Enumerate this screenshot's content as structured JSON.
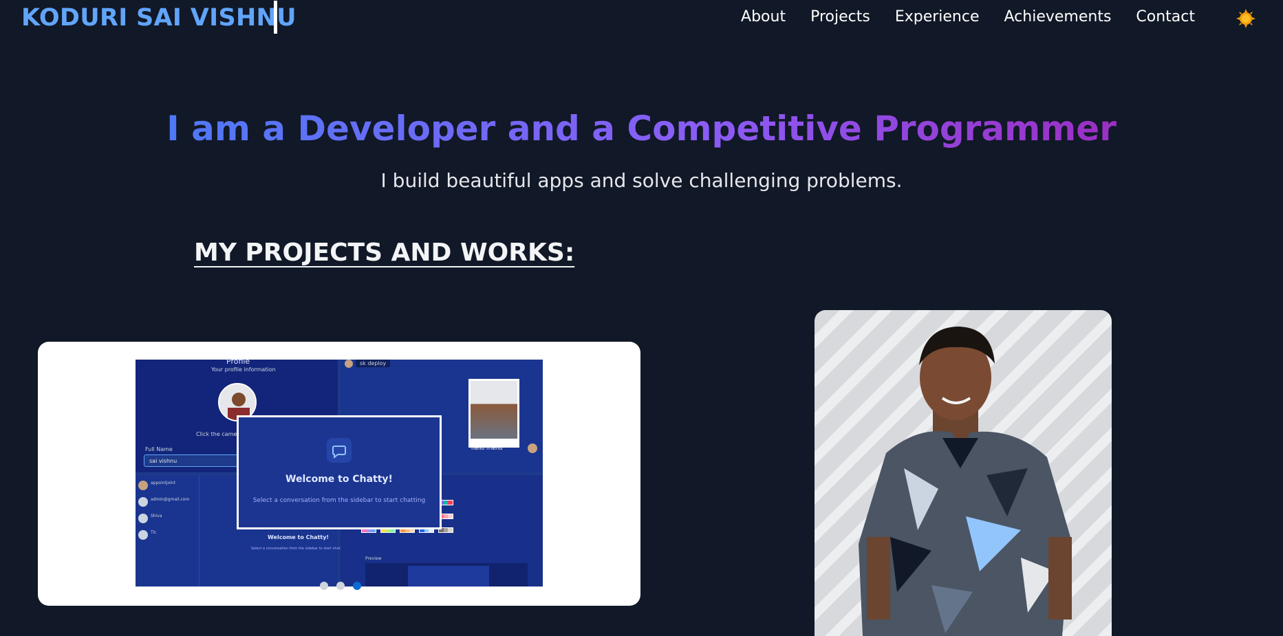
{
  "brand": {
    "name": "KODURI SAI VISHNU"
  },
  "nav": {
    "links": [
      "About",
      "Projects",
      "Experience",
      "Achievements",
      "Contact"
    ],
    "theme_icon": "sun-icon"
  },
  "hero": {
    "title": "I am a Developer and a Competitive Programmer",
    "subtitle": "I build beautiful apps and solve challenging problems."
  },
  "projects": {
    "heading": "MY PROJECTS AND WORKS:",
    "carousel": {
      "active_index": 2,
      "slide_count": 3,
      "slide": {
        "profile_heading": "Profile",
        "profile_sub": "Your profile information",
        "camera_hint": "Click the camera icon",
        "full_name_label": "Full Name",
        "full_name_value": "sai vishnu",
        "chat_user": "sk deploy",
        "photo_caption": "hello friend",
        "welcome_title": "Welcome to Chatty!",
        "welcome_sub": "Select a conversation from the sidebar to start chatting",
        "small_welcome_title": "Welcome to Chatty!",
        "small_welcome_sub": "Select a conversation from the sidebar to start chatting",
        "contacts": [
          "appointjoint",
          "admin@gmail.com",
          "Shiva",
          "Tic"
        ],
        "preview_label": "Preview"
      }
    }
  },
  "colors": {
    "background": "#111827",
    "brand": "#60a5fa",
    "gradient_start": "#3b82f6",
    "gradient_end": "#a21caf",
    "sun": "#f59e0b"
  }
}
